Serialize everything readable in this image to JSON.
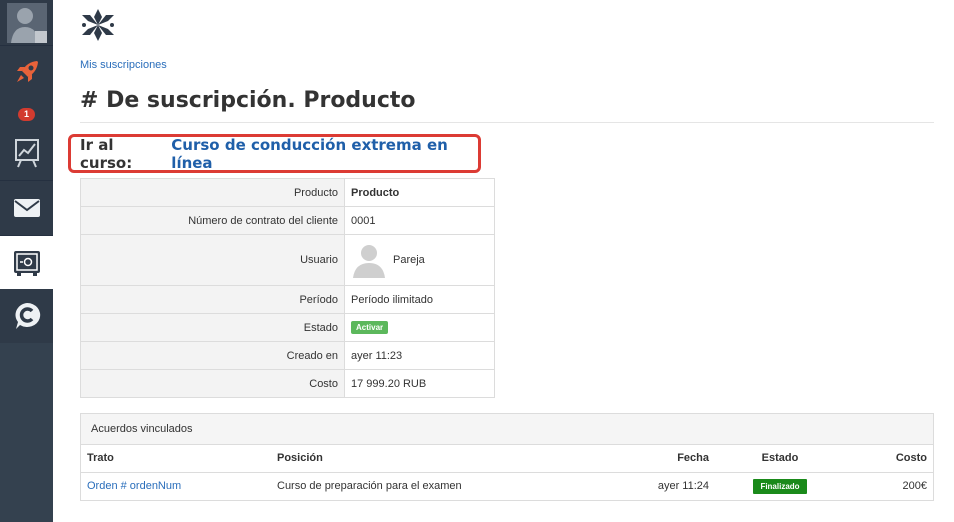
{
  "sidebar": {
    "items": [
      {
        "name": "user-avatar-icon"
      },
      {
        "name": "rocket-icon"
      },
      {
        "name": "notifications-badge",
        "badge": "1"
      },
      {
        "name": "chart-icon"
      },
      {
        "name": "mail-icon"
      },
      {
        "name": "safe-icon"
      },
      {
        "name": "chat-icon"
      }
    ],
    "colors": {
      "bg": "#2f3a48",
      "rocket": "#e8623a",
      "badge": "#d23b2f"
    }
  },
  "breadcrumb": "Mis suscripciones",
  "page_title": "# De suscripción. Producto",
  "course": {
    "prefix": "Ir al curso:",
    "link": "Curso de conducción extrema en línea"
  },
  "details": [
    {
      "label": "Producto",
      "value": "Producto"
    },
    {
      "label": "Número de contrato del cliente",
      "value": "0001"
    },
    {
      "label": "Usuario",
      "value": "Pareja"
    },
    {
      "label": "Período",
      "value": "Período ilimitado"
    },
    {
      "label": "Estado",
      "value": "Activar"
    },
    {
      "label": "Creado en",
      "value": "ayer 11:23"
    },
    {
      "label": "Costo",
      "value": "17 999.20 RUB"
    }
  ],
  "linked": {
    "title": "Acuerdos vinculados",
    "headers": {
      "deal": "Trato",
      "position": "Posición",
      "date": "Fecha",
      "status": "Estado",
      "cost": "Costo"
    },
    "rows": [
      {
        "deal": "Orden # ordenNum",
        "position": "Curso de preparación para el examen",
        "date": "ayer 11:24",
        "status": "Finalizado",
        "cost": "200€"
      }
    ]
  }
}
